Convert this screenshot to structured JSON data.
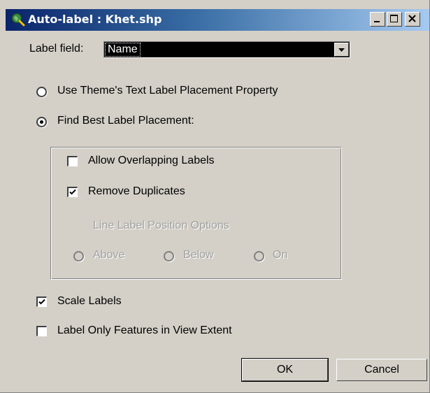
{
  "window": {
    "title": "Auto-label : Khet.shp"
  },
  "title_buttons": {
    "minimize": "_",
    "maximize": "□",
    "close": "×"
  },
  "label_field": {
    "label": "Label field:",
    "selected": "Name"
  },
  "placement": {
    "option_theme": "Use Theme's Text Label Placement Property",
    "option_best": "Find Best Label Placement:",
    "selected": "best"
  },
  "group": {
    "allow_overlapping": {
      "label": "Allow Overlapping Labels",
      "checked": false
    },
    "remove_duplicates": {
      "label": "Remove Duplicates",
      "checked": true
    },
    "line_options_title": "Line Label Position Options",
    "line_options": [
      "Above",
      "Below",
      "On"
    ]
  },
  "scale_labels": {
    "label": "Scale Labels",
    "checked": true
  },
  "view_extent": {
    "label": "Label Only Features in View Extent",
    "checked": false
  },
  "buttons": {
    "ok": "OK",
    "cancel": "Cancel"
  },
  "colors": {
    "title_start": "#0a246a",
    "title_end": "#a6caf0",
    "face": "#d4d0c8"
  }
}
